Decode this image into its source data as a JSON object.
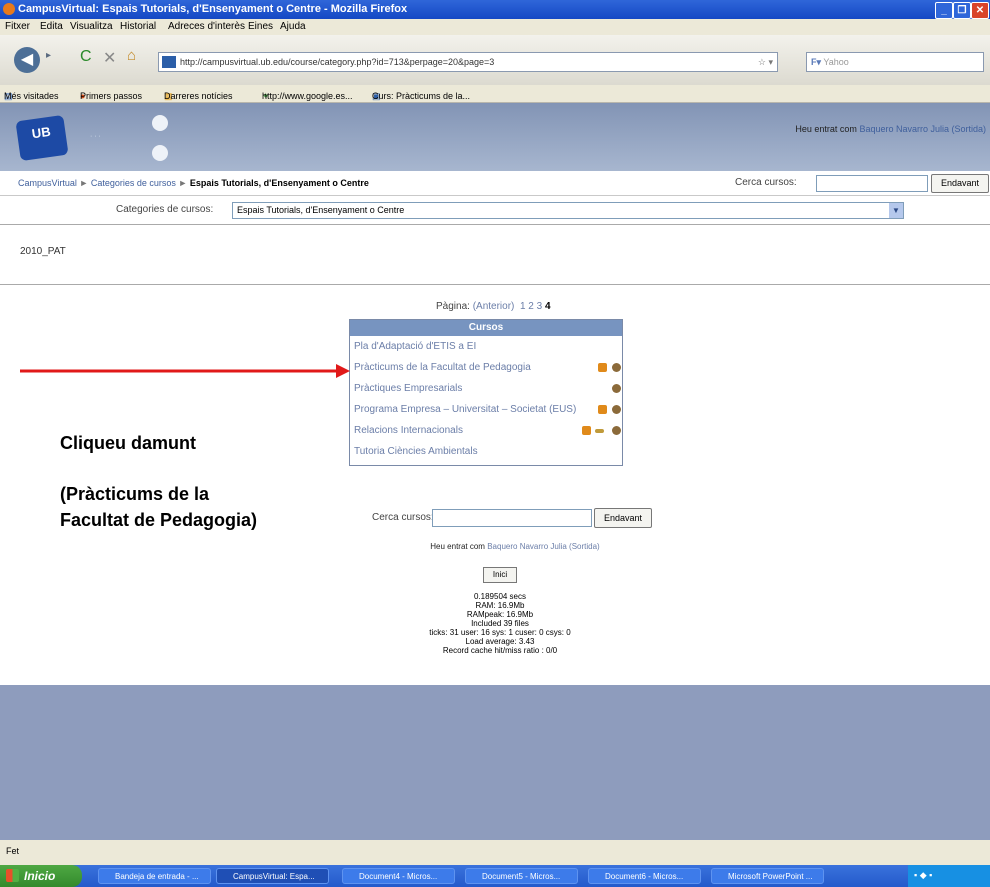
{
  "window": {
    "title": "CampusVirtual: Espais Tutorials, d'Ensenyament o Centre - Mozilla Firefox",
    "buttons": [
      "_",
      "❐",
      "✕"
    ]
  },
  "menu": [
    "Fitxer",
    "Edita",
    "Visualitza",
    "Historial",
    "Adreces d'interès",
    "Eines",
    "Ajuda"
  ],
  "nav": {
    "url": "http://campusvirtual.ub.edu/course/category.php?id=713&perpage=20&page=3",
    "search_placeholder": "Yahoo"
  },
  "bookmarks": [
    "Més visitades",
    "Primers passos",
    "Darreres notícies",
    "http://www.google.es...",
    "Curs: Pràcticums de la..."
  ],
  "header": {
    "logo": "UB",
    "user_text": "Heu entrat com",
    "user_name": "Baquero Navarro Julia (Sortida)"
  },
  "breadcrumb": {
    "root": "CampusVirtual",
    "cat": "Categories de cursos",
    "current": "Espais Tutorials, d'Ensenyament o Centre",
    "sep": "►"
  },
  "search": {
    "label": "Cerca cursos:",
    "button": "Endavant"
  },
  "category": {
    "label": "Categories de cursos:",
    "selected": "Espais Tutorials, d'Ensenyament o Centre"
  },
  "subcategory": "2010_PAT",
  "pagination": {
    "label": "Pàgina:",
    "prev": "(Anterior)",
    "pages": [
      "1",
      "2",
      "3"
    ],
    "current": "4"
  },
  "courses": {
    "header": "Cursos",
    "items": [
      {
        "name": "Pla d'Adaptació d'ETIS a EI",
        "icons": []
      },
      {
        "name": "Pràcticums de la Facultat de Pedagogia",
        "icons": [
          "book-icon",
          "info-icon"
        ]
      },
      {
        "name": "Pràctiques Empresarials",
        "icons": [
          "info-icon"
        ]
      },
      {
        "name": "Programa Empresa – Universitat – Societat (EUS)",
        "icons": [
          "book-icon",
          "info-icon"
        ]
      },
      {
        "name": "Relacions Internacionals",
        "icons": [
          "book-icon",
          "key-icon",
          "info-icon"
        ]
      },
      {
        "name": "Tutoria Ciències Ambientals",
        "icons": []
      }
    ]
  },
  "annotation": {
    "line1": "Cliqueu damunt",
    "line2": "(Pràcticums de la",
    "line3": "Facultat de Pedagogia)",
    "arrow_color": "#e11919"
  },
  "bottom": {
    "home": "Inici",
    "stats": [
      "0.189504 secs",
      "RAM: 16.9Mb",
      "RAMpeak: 16.9Mb",
      "Included 39 files",
      "ticks: 31 user: 16 sys: 1 cuser: 0 csys: 0",
      "Load average: 3.43",
      "Record cache hit/miss ratio : 0/0"
    ]
  },
  "status": "Fet",
  "taskbar": {
    "start": "Inicio",
    "tasks": [
      "Bandeja de entrada - ...",
      "CampusVirtual: Espa...",
      "Document4 - Micros...",
      "Document5 - Micros...",
      "Document6 - Micros...",
      "Microsoft PowerPoint ..."
    ]
  }
}
